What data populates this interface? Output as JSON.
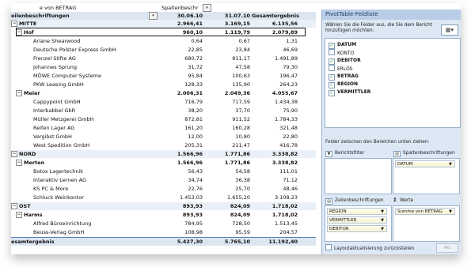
{
  "pivot": {
    "header_row1": {
      "label": "e von BETRAG",
      "col_label": "Spaltenbeschr"
    },
    "header_row2": {
      "label": "eilenbeschriftungen",
      "c1": "30.06.10",
      "c2": "31.07.10",
      "c3": "Gesamtergebnis"
    },
    "rows": [
      {
        "label": "MITTE",
        "c1": "2.966,41",
        "c2": "3.169,15",
        "c3": "6.135,56",
        "level": 0,
        "bold": true,
        "expander": "−"
      },
      {
        "label": "Hof",
        "c1": "960,10",
        "c2": "1.119,79",
        "c3": "2.079,89",
        "level": 1,
        "bold": true,
        "expander": "−",
        "selected": true
      },
      {
        "label": "Ariane Shearwood",
        "c1": "0,64",
        "c2": "0,67",
        "c3": "1,31",
        "level": 2
      },
      {
        "label": "Deutsche Polster Express GmbH",
        "c1": "22,85",
        "c2": "23,84",
        "c3": "46,69",
        "level": 2
      },
      {
        "label": "Frenzel Stifte AG",
        "c1": "680,72",
        "c2": "811,17",
        "c3": "1.491,89",
        "level": 2
      },
      {
        "label": "Johannes Sprung",
        "c1": "31,72",
        "c2": "47,58",
        "c3": "79,30",
        "level": 2
      },
      {
        "label": "MÖWE Computer Systeme",
        "c1": "95,84",
        "c2": "100,63",
        "c3": "196,47",
        "level": 2
      },
      {
        "label": "PKW Leasing GmbH",
        "c1": "128,33",
        "c2": "135,90",
        "c3": "264,23",
        "level": 2
      },
      {
        "label": "Meier",
        "c1": "2.006,31",
        "c2": "2.049,36",
        "c3": "4.055,67",
        "level": 1,
        "bold": true,
        "expander": "−"
      },
      {
        "label": "Cappypoint GmbH",
        "c1": "716,79",
        "c2": "717,59",
        "c3": "1.434,38",
        "level": 2
      },
      {
        "label": "Interbabbel GbR",
        "c1": "38,20",
        "c2": "37,70",
        "c3": "75,90",
        "level": 2
      },
      {
        "label": "Müller Metzgerei GmbH",
        "c1": "872,81",
        "c2": "911,52",
        "c3": "1.784,33",
        "level": 2
      },
      {
        "label": "Reifen Lager AG",
        "c1": "161,20",
        "c2": "160,28",
        "c3": "321,48",
        "level": 2
      },
      {
        "label": "Vergibst GmbH",
        "c1": "12,00",
        "c2": "10,80",
        "c3": "22,80",
        "level": 2
      },
      {
        "label": "West Spedition GmbH",
        "c1": "205,31",
        "c2": "211,47",
        "c3": "416,78",
        "level": 2
      },
      {
        "label": "NORD",
        "c1": "1.566,96",
        "c2": "1.771,86",
        "c3": "3.338,82",
        "level": 0,
        "bold": true,
        "expander": "−"
      },
      {
        "label": "Merten",
        "c1": "1.566,96",
        "c2": "1.771,86",
        "c3": "3.338,82",
        "level": 1,
        "bold": true,
        "expander": "−"
      },
      {
        "label": "Botox Lagertechnik",
        "c1": "56,43",
        "c2": "54,58",
        "c3": "111,01",
        "level": 2
      },
      {
        "label": "Interaktiv Lernen AG",
        "c1": "34,74",
        "c2": "36,38",
        "c3": "71,12",
        "level": 2
      },
      {
        "label": "KS PC & More",
        "c1": "22,76",
        "c2": "25,70",
        "c3": "48,46",
        "level": 2
      },
      {
        "label": "Schluck Weinkontor",
        "c1": "1.453,03",
        "c2": "1.655,20",
        "c3": "3.108,23",
        "level": 2
      },
      {
        "label": "OST",
        "c1": "893,93",
        "c2": "824,09",
        "c3": "1.718,02",
        "level": 0,
        "bold": true,
        "expander": "−"
      },
      {
        "label": "Harms",
        "c1": "893,93",
        "c2": "824,09",
        "c3": "1.718,02",
        "level": 1,
        "bold": true,
        "expander": "−"
      },
      {
        "label": "Alfred Büroeinrichtung",
        "c1": "784,95",
        "c2": "728,50",
        "c3": "1.513,45",
        "level": 2
      },
      {
        "label": "Beuss-Verlag GmbH",
        "c1": "108,98",
        "c2": "95,59",
        "c3": "204,57",
        "level": 2
      },
      {
        "label": "esamtergebnis",
        "c1": "5.427,30",
        "c2": "5.765,10",
        "c3": "11.192,40",
        "level": 0,
        "bold": true,
        "total": true
      }
    ]
  },
  "panel": {
    "title": "PivotTable-Feldliste",
    "choose_text": "Wählen Sie die Felder aus, die Sie dem Bericht hinzufügen möchten:",
    "fields": [
      {
        "label": "DATUM",
        "checked": true
      },
      {
        "label": "KONTO",
        "checked": false
      },
      {
        "label": "DEBITOR",
        "checked": true
      },
      {
        "label": "ERLÖS",
        "checked": false
      },
      {
        "label": "BETRAG",
        "checked": true
      },
      {
        "label": "REGION",
        "checked": true
      },
      {
        "label": "VERMITTLER",
        "checked": true
      }
    ],
    "drag_text": "Felder zwischen den Bereichen unten ziehen:",
    "report_filter_label": "Berichtsfilter",
    "column_labels_label": "Spaltenbeschriftungen",
    "row_labels_label": "Zeilenbeschriftungen",
    "values_label": "Werte",
    "values_symbol": "Σ",
    "column_fields": [
      "DATUM"
    ],
    "row_fields": [
      "REGION",
      "VERMITTLER",
      "DEBITOR"
    ],
    "value_fields": [
      "Summe von BETRAG"
    ],
    "defer_label": "Layoutaktualisierung zurückstellen",
    "update_button": "Akt"
  }
}
